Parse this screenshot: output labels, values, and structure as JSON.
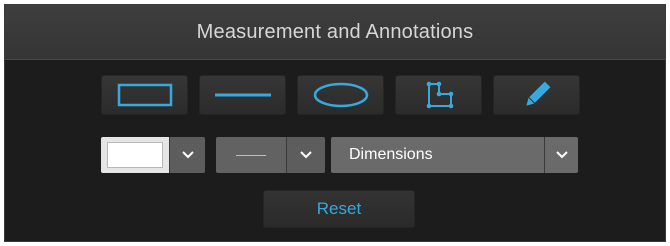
{
  "header": {
    "title": "Measurement and Annotations"
  },
  "tools": [
    {
      "name": "rectangle-tool",
      "icon": "rectangle-icon"
    },
    {
      "name": "line-tool",
      "icon": "line-icon"
    },
    {
      "name": "ellipse-tool",
      "icon": "ellipse-icon"
    },
    {
      "name": "polygon-tool",
      "icon": "polygon-icon"
    },
    {
      "name": "freehand-tool",
      "icon": "pencil-icon"
    }
  ],
  "color_picker": {
    "selected_color": "#ffffff",
    "icon": "chevron-down-icon"
  },
  "line_style": {
    "selected": "—",
    "icon": "chevron-down-icon"
  },
  "annotation_type": {
    "selected": "Dimensions",
    "icon": "chevron-down-icon"
  },
  "reset_button": {
    "label": "Reset"
  },
  "colors": {
    "accent": "#38a9dd",
    "panel": "#1c1c1c",
    "header": "#3b3b3b"
  }
}
